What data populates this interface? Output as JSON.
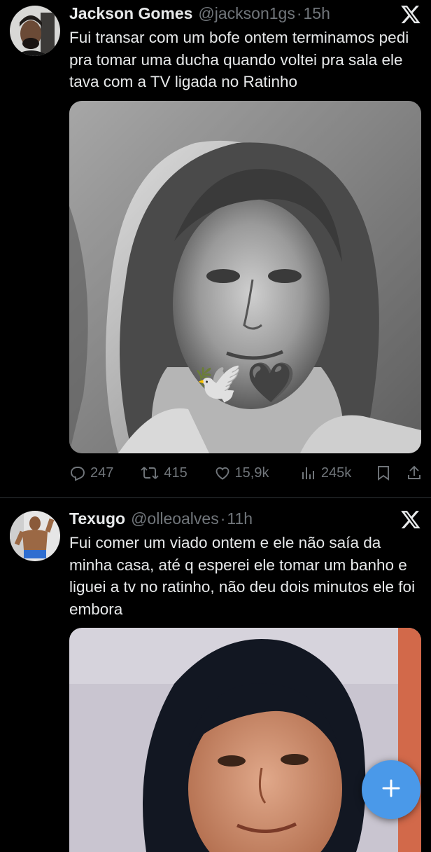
{
  "tweets": [
    {
      "name": "Jackson Gomes",
      "handle": "@jackson1gs",
      "dot": "·",
      "time": "15h",
      "text": "Fui transar com um bofe ontem terminamos pedi pra tomar uma ducha quando voltei pra sala ele tava com a TV ligada no Ratinho",
      "media_overlay": "🕊️🖤",
      "replies": "247",
      "retweets": "415",
      "likes": "15,9k",
      "views": "245k"
    },
    {
      "name": "Texugo",
      "handle": "@olleoalves",
      "dot": "·",
      "time": "11h",
      "text": "Fui comer um viado ontem e ele não saía da minha casa, até q esperei ele tomar um banho e liguei a tv no ratinho, não deu dois minutos ele foi embora"
    }
  ],
  "colors": {
    "background": "#000000",
    "text_primary": "#e7e9ea",
    "text_secondary": "#71767b",
    "divider": "#2f3336",
    "fab": "#4a99e9"
  },
  "icons": [
    "x-logo-icon",
    "reply-icon",
    "retweet-icon",
    "like-icon",
    "views-icon",
    "bookmark-icon",
    "share-icon",
    "plus-icon"
  ]
}
